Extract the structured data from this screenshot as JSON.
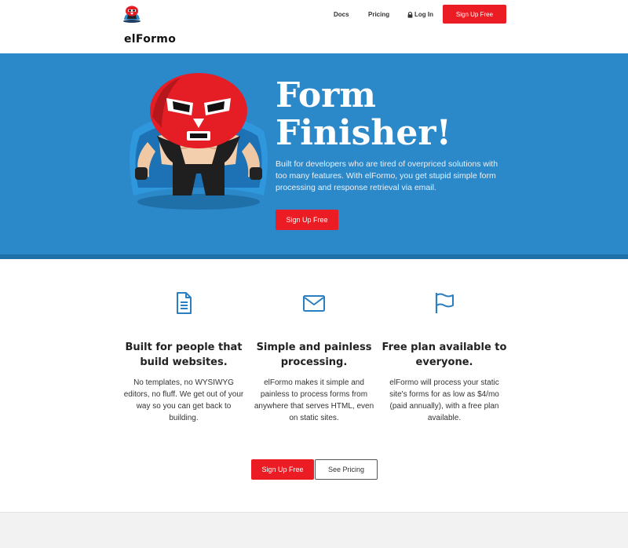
{
  "nav": {
    "brand": "elFormo",
    "logo_icon": "luchador-mask-logo",
    "links": [
      {
        "label": "Docs"
      },
      {
        "label": "Pricing"
      },
      {
        "label": "Log In",
        "icon": "lock-icon"
      }
    ],
    "signup_label": "Sign Up Free"
  },
  "hero": {
    "title_line1": "Form",
    "title_line2": "Finisher!",
    "description": "Built for developers who are tired of overpriced solutions with too many features. With elFormo, you get stupid simple form processing and response retrieval via email.",
    "signup_label": "Sign Up Free",
    "background": "#2b88c9"
  },
  "features": [
    {
      "icon": "document-icon",
      "title": "Built for people that build websites.",
      "description": "No templates, no WYSIWYG editors, no fluff. We get out of your way so you can get back to building."
    },
    {
      "icon": "envelope-icon",
      "title": "Simple and painless processing.",
      "description": "elFormo makes it simple and painless to process forms from anywhere that serves HTML, even on static sites."
    },
    {
      "icon": "flag-icon",
      "title": "Free plan available to everyone.",
      "description": "elFormo will process your static site's forms for as low as $4/mo (paid annually), with a free plan available."
    }
  ],
  "cta": {
    "signup_label": "Sign Up Free",
    "pricing_label": "See Pricing"
  },
  "colors": {
    "accent_red": "#ec1c24",
    "hero_blue": "#2b88c9",
    "icon_blue": "#2b7fc1"
  }
}
